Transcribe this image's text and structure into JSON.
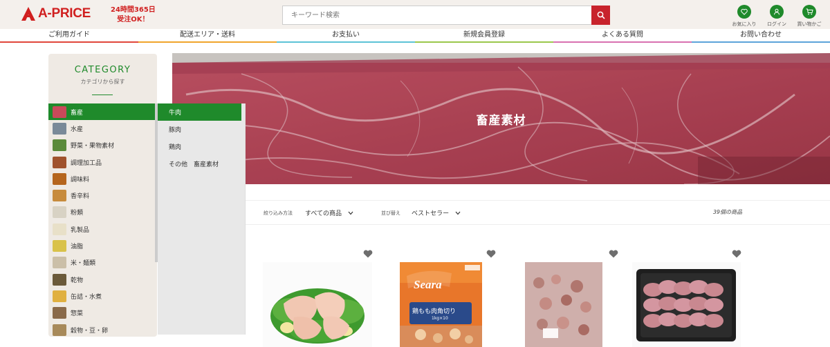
{
  "header": {
    "logo_text": "A-PRICE",
    "promo_line1": "24時間365日",
    "promo_line2": "受注OK！",
    "search_placeholder": "キーワード検索",
    "icons": [
      {
        "name": "heart-icon",
        "label": "お気に入り"
      },
      {
        "name": "user-icon",
        "label": "ログイン"
      },
      {
        "name": "cart-icon",
        "label": "買い物かご"
      }
    ]
  },
  "nav": {
    "items": [
      {
        "label": "ご利用ガイド",
        "color": "#e0453a"
      },
      {
        "label": "配送エリア・送料",
        "color": "#f0a42a"
      },
      {
        "label": "お支払い",
        "color": "#5bc2d6"
      },
      {
        "label": "新規会員登録",
        "color": "#9ac74a"
      },
      {
        "label": "よくある質問",
        "color": "#d86fb0"
      },
      {
        "label": "お問い合わせ",
        "color": "#5ba3d9"
      }
    ]
  },
  "category": {
    "title": "CATEGORY",
    "subtitle": "カテゴリから探す",
    "items": [
      {
        "label": "畜産",
        "thumb": "#c94a5a"
      },
      {
        "label": "水産",
        "thumb": "#7a8a99"
      },
      {
        "label": "野菜・果物素材",
        "thumb": "#5a8a3a"
      },
      {
        "label": "調理加工品",
        "thumb": "#a0522d"
      },
      {
        "label": "調味料",
        "thumb": "#b5651d"
      },
      {
        "label": "香辛料",
        "thumb": "#c78b3c"
      },
      {
        "label": "粉類",
        "thumb": "#d8d2c4"
      },
      {
        "label": "乳製品",
        "thumb": "#e8e0c8"
      },
      {
        "label": "油脂",
        "thumb": "#d9c24a"
      },
      {
        "label": "米・麺類",
        "thumb": "#cbbfa8"
      },
      {
        "label": "乾物",
        "thumb": "#6b5a3a"
      },
      {
        "label": "缶詰・水煮",
        "thumb": "#e0b040"
      },
      {
        "label": "惣菜",
        "thumb": "#8a6a4a"
      },
      {
        "label": "穀物・豆・卵",
        "thumb": "#a88a5a"
      }
    ],
    "active_index": 0
  },
  "submenu": {
    "items": [
      "牛肉",
      "豚肉",
      "鶏肉",
      "その他　畜産素材"
    ],
    "active_index": 0
  },
  "hero": {
    "title": "畜産素材"
  },
  "filter": {
    "narrow_label": "絞り込み方法",
    "narrow_value": "すべての商品",
    "sort_label": "並び替え",
    "sort_value": "ベストセラー",
    "count": "39個の商品"
  },
  "products": [
    {
      "name": "chicken-thigh"
    },
    {
      "name": "seara-chicken-cut",
      "brand": "Seara",
      "caption": "鶏もも肉角切り",
      "sub": "1kg×10"
    },
    {
      "name": "chicken-pieces"
    },
    {
      "name": "beef-tongue-slices"
    }
  ],
  "colors": {
    "accent": "#1f8a2b",
    "brand": "#d01f1f",
    "search_button": "#c8232c"
  }
}
